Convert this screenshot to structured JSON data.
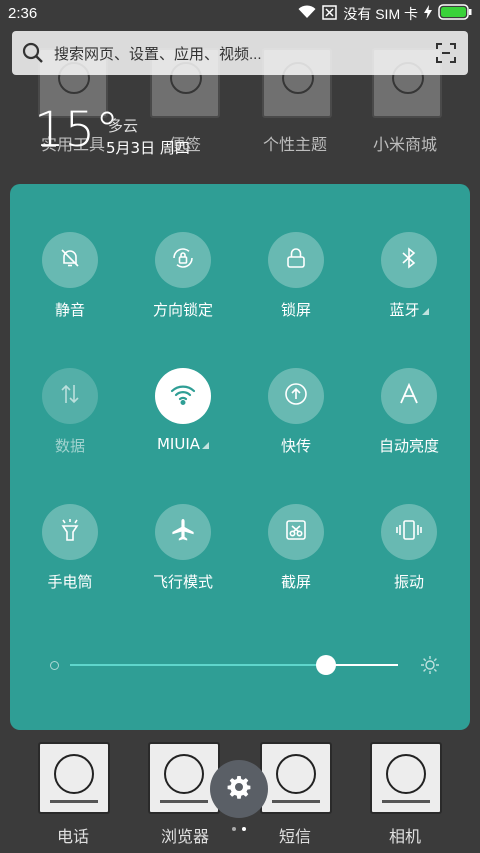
{
  "status_bar": {
    "time": "2:36",
    "no_sim_text": "没有 SIM 卡",
    "icons": [
      "wifi-icon",
      "sim-missing-icon",
      "charging-icon",
      "battery-icon"
    ],
    "battery_color": "#3ad23a"
  },
  "search": {
    "placeholder": "搜索网页、设置、应用、视频..."
  },
  "weather": {
    "temperature": "15°",
    "condition": "多云",
    "date": "5月3日 周四"
  },
  "home_labels": {
    "row1": [
      "实用工具",
      "便签",
      "个性主题",
      "小米商城"
    ],
    "dock": [
      "电话",
      "浏览器",
      "短信",
      "相机"
    ]
  },
  "quick_settings": {
    "accent_color": "#2f9e95",
    "tiles": [
      {
        "label": "静音",
        "icon": "bell-off-icon",
        "state": "off"
      },
      {
        "label": "方向锁定",
        "icon": "rotation-lock-icon",
        "state": "off"
      },
      {
        "label": "锁屏",
        "icon": "lock-icon",
        "state": "off"
      },
      {
        "label": "蓝牙",
        "icon": "bluetooth-icon",
        "state": "off"
      },
      {
        "label": "数据",
        "icon": "mobile-data-icon",
        "state": "disabled"
      },
      {
        "label": "MIUIA",
        "icon": "wifi-icon",
        "state": "on"
      },
      {
        "label": "快传",
        "icon": "upload-icon",
        "state": "off"
      },
      {
        "label": "自动亮度",
        "icon": "auto-brightness-icon",
        "state": "off"
      },
      {
        "label": "手电筒",
        "icon": "flashlight-icon",
        "state": "off"
      },
      {
        "label": "飞行模式",
        "icon": "airplane-icon",
        "state": "off"
      },
      {
        "label": "截屏",
        "icon": "screenshot-icon",
        "state": "off"
      },
      {
        "label": "振动",
        "icon": "vibrate-icon",
        "state": "off"
      }
    ],
    "brightness_level": 0.78
  }
}
